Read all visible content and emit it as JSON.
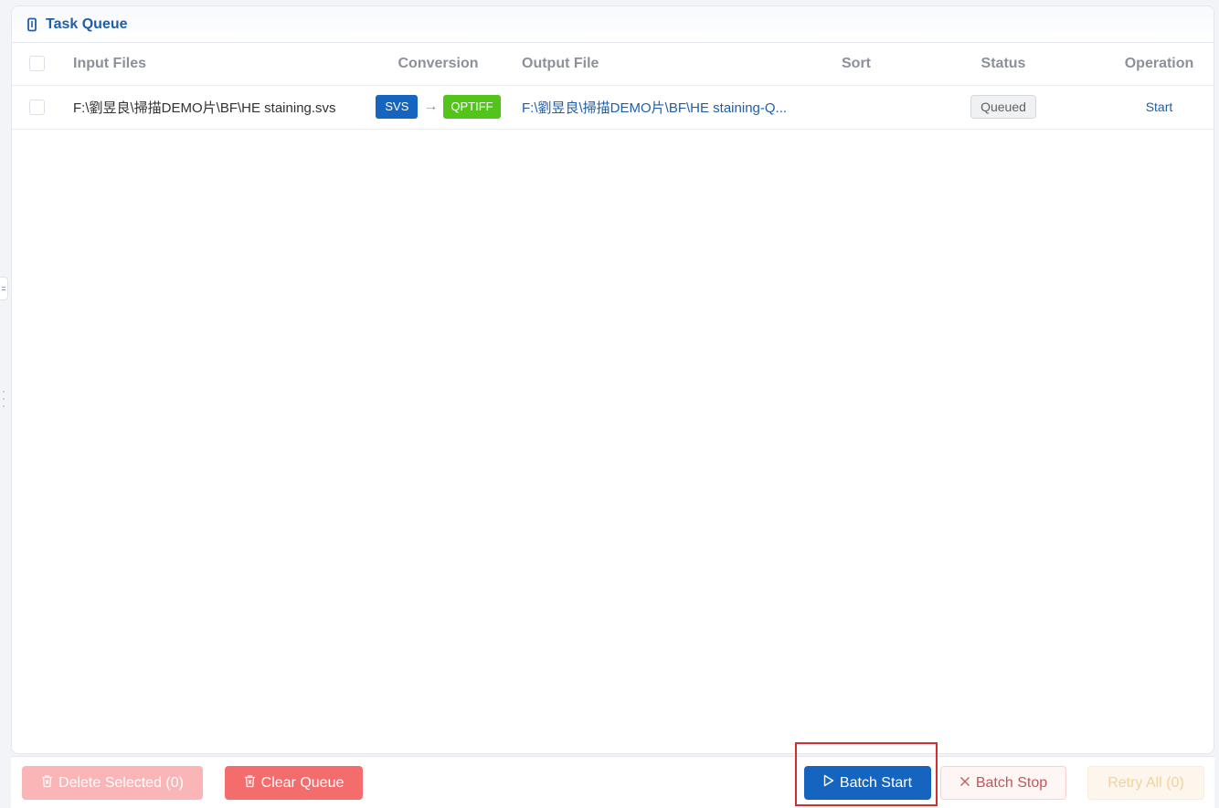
{
  "panel": {
    "title": "Task Queue",
    "title_icon": "file-icon"
  },
  "table": {
    "columns": [
      "Input Files",
      "Conversion",
      "Output File",
      "Sort",
      "Status",
      "Operation"
    ],
    "rows": [
      {
        "input_file": "F:\\劉昱良\\掃描DEMO片\\BF\\HE staining.svs",
        "from_format": "SVS",
        "arrow": "→",
        "to_format": "QPTIFF",
        "output_file": "F:\\劉昱良\\掃描DEMO片\\BF\\HE staining-Q...",
        "sort": "",
        "status": "Queued",
        "operation": "Start"
      }
    ]
  },
  "footer": {
    "delete_selected": "Delete Selected (0)",
    "clear_queue": "Clear Queue",
    "batch_start": "Batch Start",
    "batch_stop": "Batch Stop",
    "retry_all": "Retry All (0)"
  },
  "side_handle": {
    "glyph": "="
  },
  "colors": {
    "primary": "#1565c0",
    "success": "#52c41a",
    "danger": "#f56c6c",
    "highlight": "#d32f2f"
  }
}
